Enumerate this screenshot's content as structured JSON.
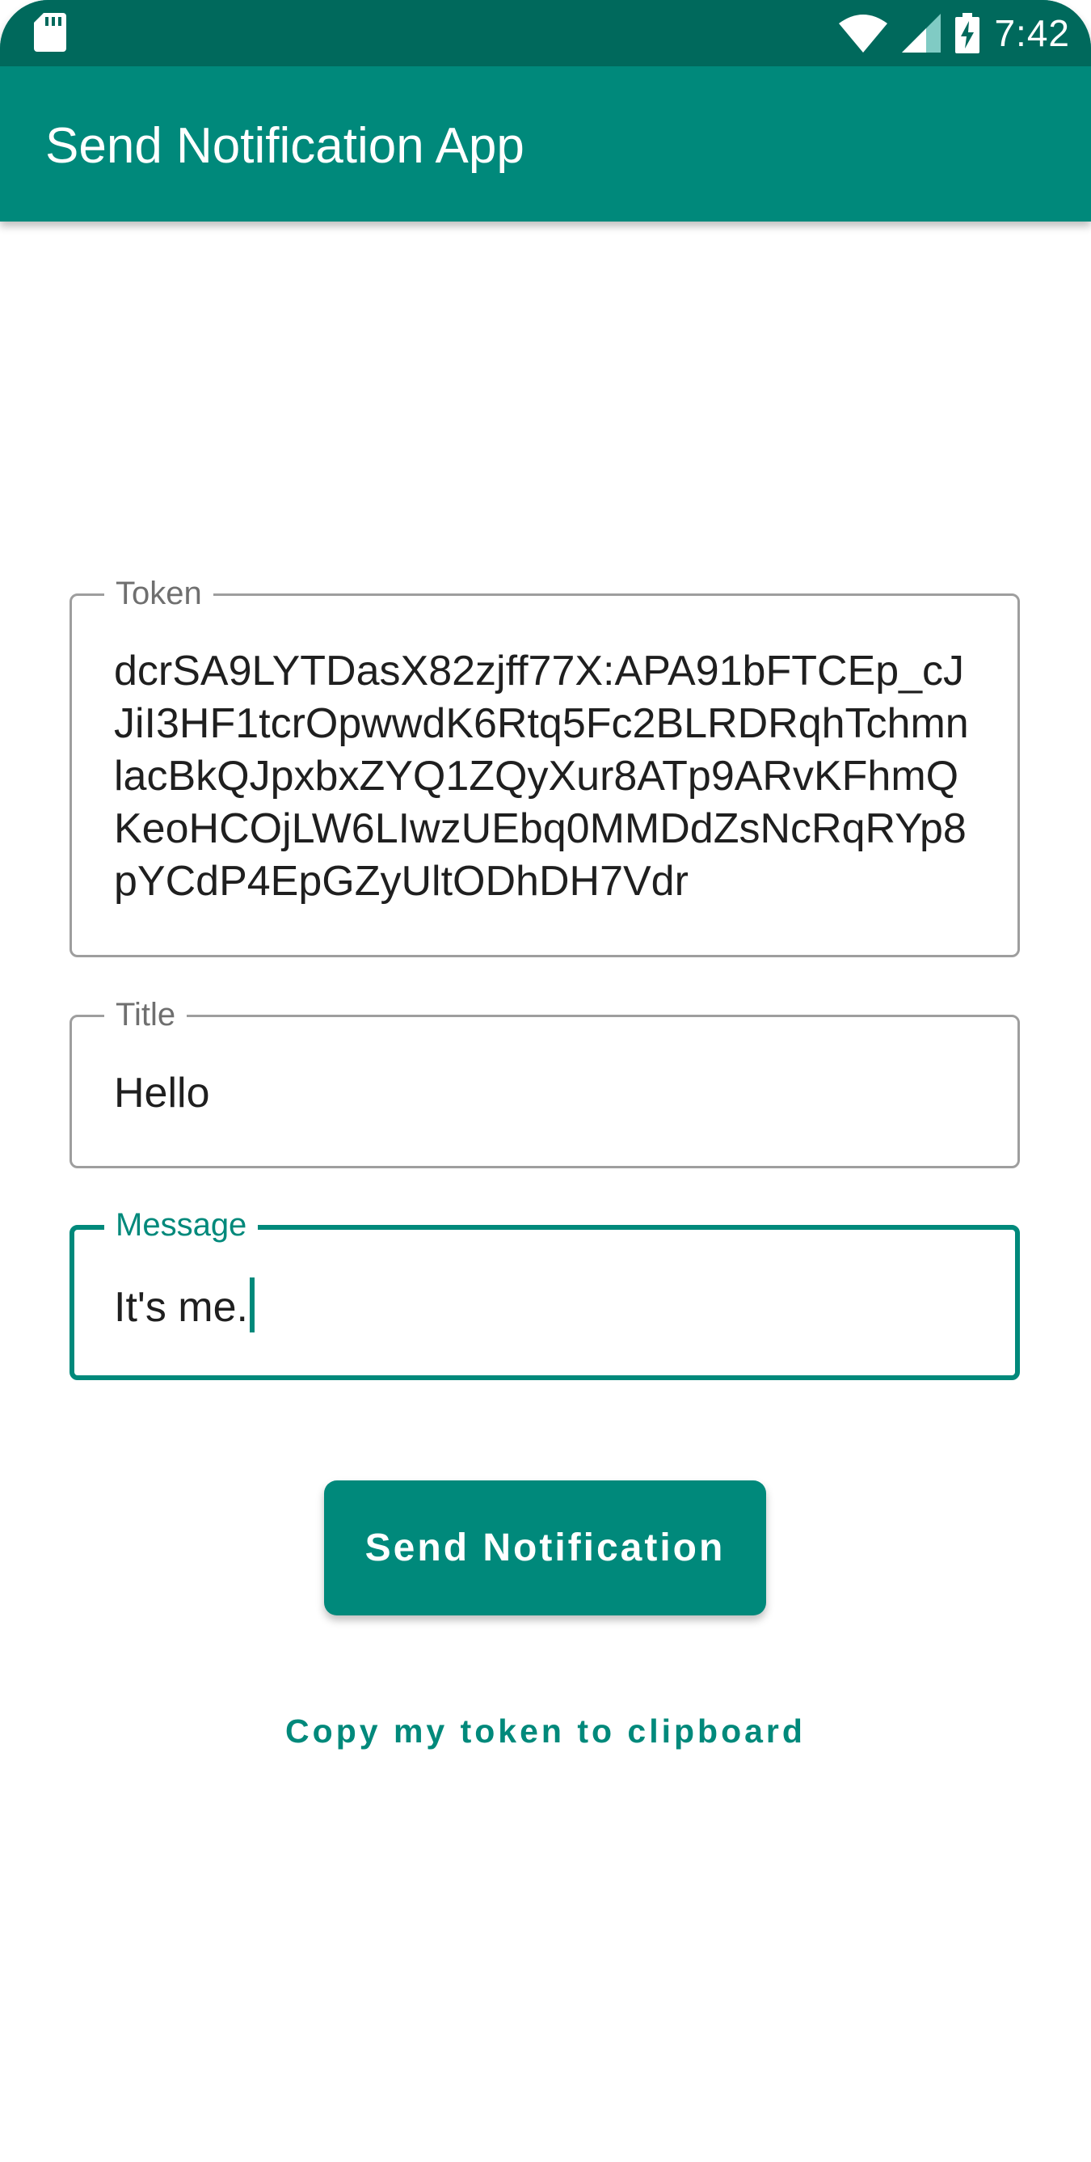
{
  "status_bar": {
    "time": "7:42",
    "icons": [
      "sd-card-icon",
      "wifi-icon",
      "cellular-signal-icon",
      "battery-charging-icon"
    ]
  },
  "app_bar": {
    "title": "Send Notification App"
  },
  "form": {
    "token": {
      "label": "Token",
      "value": "dcrSA9LYTDasX82zjff77X:APA91bFTCEp_cJJiI3HF1tcrOpwwdK6Rtq5Fc2BLRDRqhTchmnlacBkQJpxbxZYQ1ZQyXur8ATp9ARvKFhmQKeoHCOjLW6LIwzUEbq0MMDdZsNcRqRYp8pYCdP4EpGZyUltODhDH7Vdr"
    },
    "title": {
      "label": "Title",
      "value": "Hello"
    },
    "message": {
      "label": "Message",
      "value": "It's me."
    }
  },
  "actions": {
    "send_label": "Send Notification",
    "copy_label": "Copy my token to clipboard"
  },
  "colors": {
    "primary": "#00897b",
    "primary_dark": "#00695c",
    "outline": "#9e9e9e",
    "label": "#6f6f6f"
  }
}
